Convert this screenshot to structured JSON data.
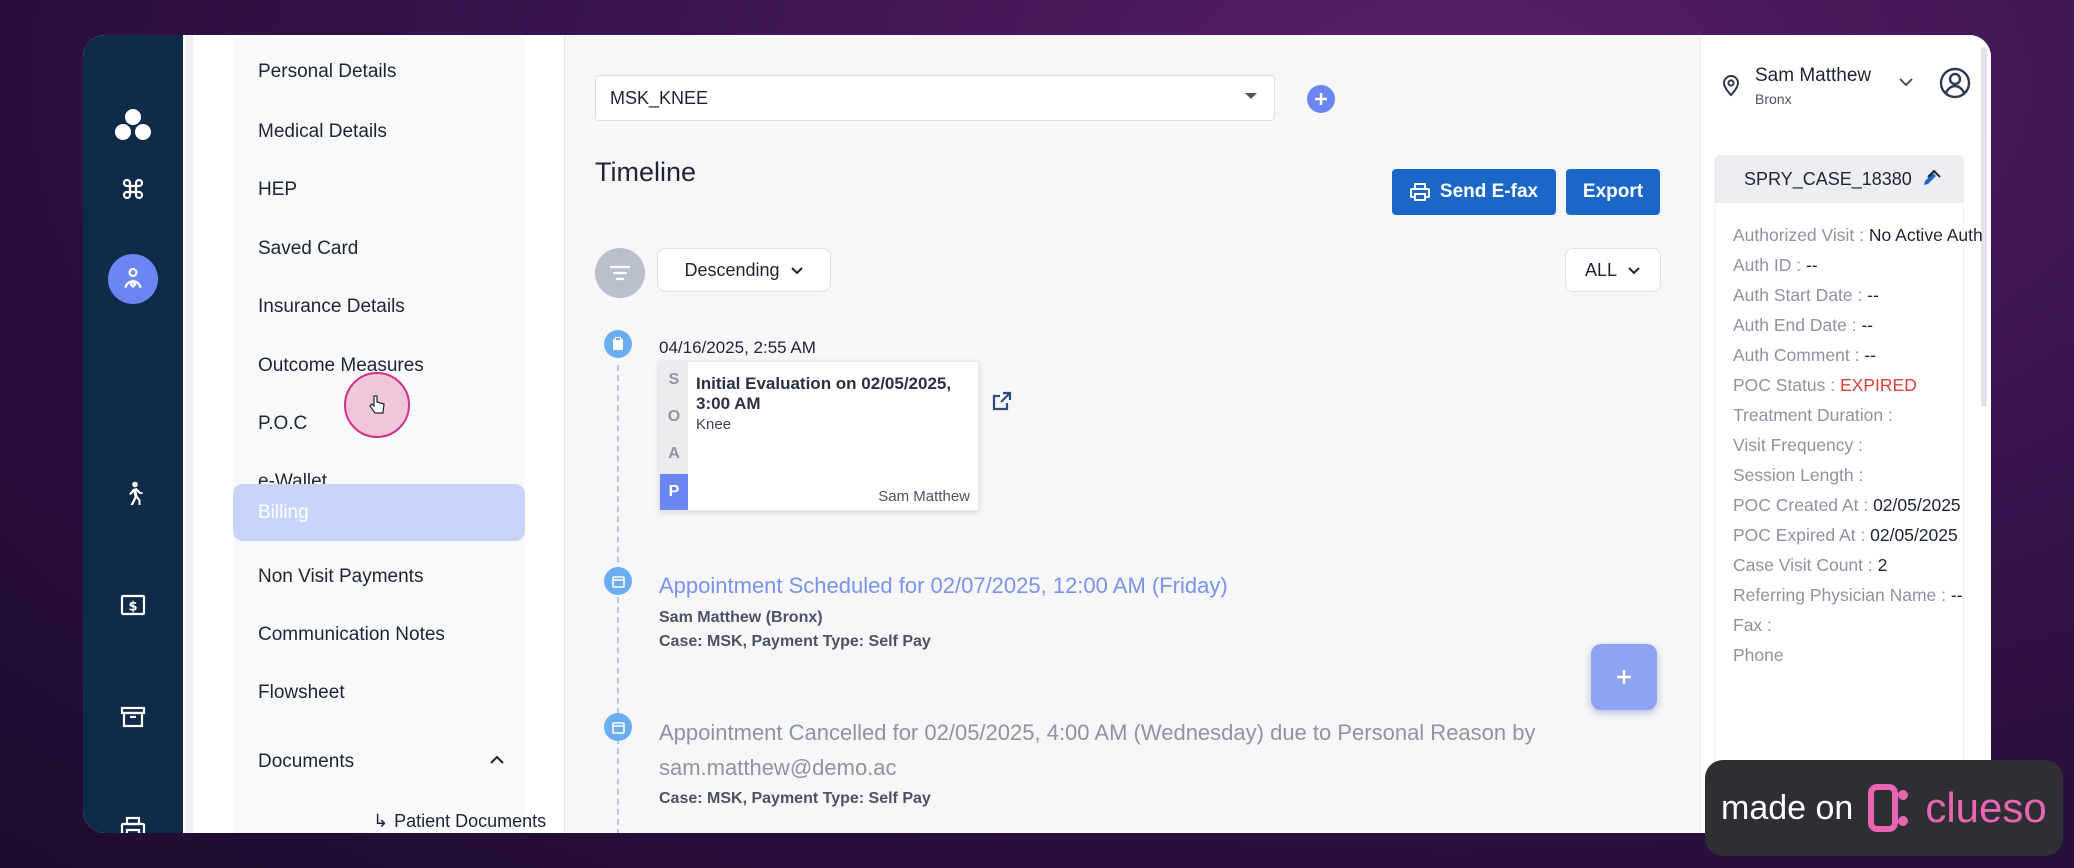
{
  "rail": {
    "icons": [
      "logo-icon",
      "dashboard-icon",
      "patient-icon",
      "exercise-icon",
      "billing-icon",
      "archive-icon",
      "printer-icon"
    ]
  },
  "menu": {
    "items": [
      {
        "label": "Personal Details"
      },
      {
        "label": "Medical Details"
      },
      {
        "label": "HEP"
      },
      {
        "label": "Saved Card"
      },
      {
        "label": "Insurance Details"
      },
      {
        "label": "Outcome Measures"
      },
      {
        "label": "P.O.C"
      },
      {
        "label": "e-Wallet"
      },
      {
        "label": "Billing",
        "active": true
      },
      {
        "label": "Non Visit Payments"
      },
      {
        "label": "Communication Notes"
      },
      {
        "label": "Flowsheet"
      },
      {
        "label": "Documents"
      }
    ],
    "sub_item": "Patient Documents"
  },
  "main": {
    "case_select": "MSK_KNEE",
    "title": "Timeline",
    "send_efax": "Send E-fax",
    "export": "Export",
    "sort": "Descending",
    "filter": "ALL",
    "entries": {
      "soap": {
        "date": "04/16/2025, 2:55 AM",
        "letters": [
          "S",
          "O",
          "A",
          "P"
        ],
        "title": "Initial Evaluation on 02/05/2025, 3:00 AM",
        "body_part": "Knee",
        "provider": "Sam Matthew"
      },
      "appt1": {
        "title": "Appointment Scheduled for 02/07/2025, 12:00 AM (Friday)",
        "line1": "Sam Matthew (Bronx)",
        "line2": "Case: MSK, Payment Type: Self Pay"
      },
      "appt2": {
        "title": "Appointment Cancelled for 02/05/2025, 4:00 AM (Wednesday) due to Personal Reason by sam.matthew@demo.ac",
        "line2": "Case: MSK, Payment Type: Self Pay"
      }
    }
  },
  "right": {
    "user_name": "Sam Matthew",
    "user_location": "Bronx",
    "case_id": "SPRY_CASE_18380",
    "details": [
      {
        "label": "Authorized Visit :",
        "value": "No Active Auth"
      },
      {
        "label": "Auth ID :",
        "value": "--"
      },
      {
        "label": "Auth Start Date :",
        "value": "--"
      },
      {
        "label": "Auth End Date :",
        "value": "--"
      },
      {
        "label": "Auth Comment :",
        "value": "--"
      },
      {
        "label": "POC Status :",
        "value": "EXPIRED"
      },
      {
        "label": "Treatment Duration :",
        "value": ""
      },
      {
        "label": "Visit Frequency :",
        "value": ""
      },
      {
        "label": "Session Length :",
        "value": ""
      },
      {
        "label": "POC Created At :",
        "value": "02/05/2025"
      },
      {
        "label": "POC Expired At :",
        "value": "02/05/2025"
      },
      {
        "label": "Case Visit Count :",
        "value": "2"
      },
      {
        "label": "Referring Physician Name :",
        "value": "--"
      },
      {
        "label": "Fax :",
        "value": ""
      },
      {
        "label": "Phone",
        "value": ""
      }
    ]
  },
  "badge": {
    "made_on": "made on",
    "brand": "clueso"
  },
  "colors": {
    "rail": "#102a4a",
    "accent": "#6b86f2",
    "primary": "#1a67c8",
    "expired": "#e0403a"
  }
}
